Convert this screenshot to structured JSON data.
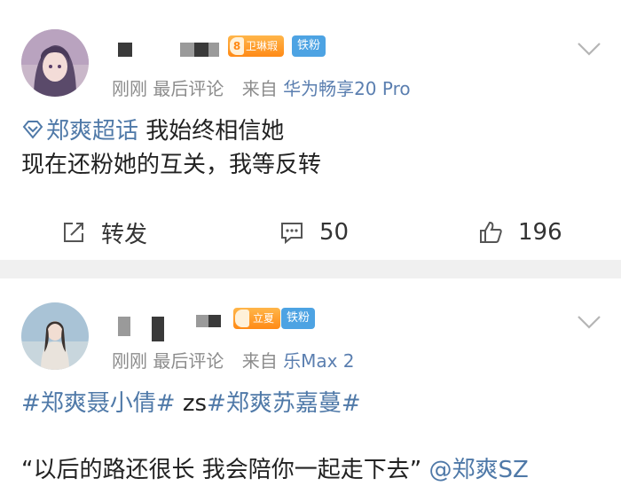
{
  "posts": [
    {
      "badges": {
        "level": "8",
        "level_label": "卫琳瑕",
        "fan": "铁粉"
      },
      "meta": {
        "time": "刚刚",
        "sort": "最后评论",
        "from": "来自",
        "device": "华为畅享20 Pro"
      },
      "topic": "郑爽超话",
      "line1": "我始终相信她",
      "line2": "现在还粉她的互关，我等反转",
      "actions": {
        "repost": "转发",
        "comments": "50",
        "likes": "196"
      }
    },
    {
      "badges": {
        "level_label": "立夏",
        "fan": "铁粉"
      },
      "meta": {
        "time": "刚刚",
        "sort": "最后评论",
        "from": "来自",
        "device": "乐Max 2"
      },
      "tags_line": {
        "tag1": "#郑爽聂小倩#",
        "text": " zs",
        "tag2": "#郑爽苏嘉蔓#"
      },
      "quote_line": {
        "text": "“以后的路还很长 我会陪你一起走下去” ",
        "mention": "@郑爽SZ"
      }
    }
  ],
  "colors": {
    "link": "#4f79a8",
    "meta": "#8c8c8c",
    "device": "#5b7fb0",
    "level_badge": "#ff8a16",
    "fan_badge": "#4da3e3",
    "separator": "#f0f0f0"
  },
  "icons": [
    "share-icon",
    "comment-icon",
    "like-icon",
    "chevron-down-icon",
    "super-topic-icon"
  ]
}
